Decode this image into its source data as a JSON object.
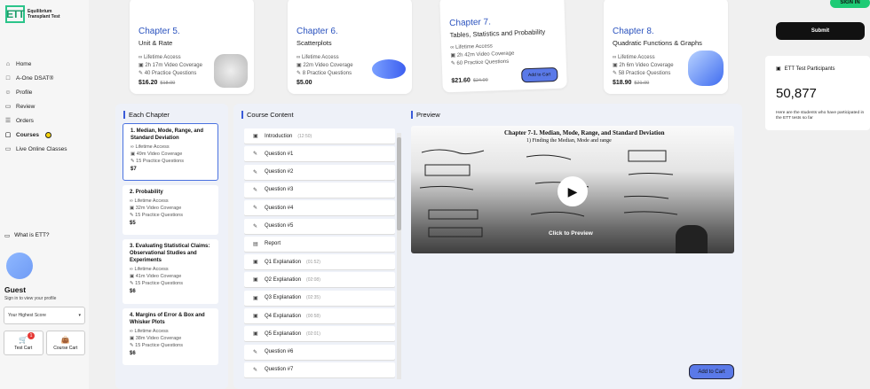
{
  "logo": {
    "mark": "ETT",
    "line1": "Equilibrium",
    "line2": "Transplant Test"
  },
  "nav": [
    {
      "icon": "⌂",
      "label": "Home"
    },
    {
      "icon": "□",
      "label": "A-One DSAT®"
    },
    {
      "icon": "☺",
      "label": "Profile"
    },
    {
      "icon": "▭",
      "label": "Review"
    },
    {
      "icon": "☰",
      "label": "Orders"
    },
    {
      "icon": "▢",
      "label": "Courses"
    },
    {
      "icon": "▭",
      "label": "Live Online Classes"
    }
  ],
  "sidebar": {
    "whatis": "What is ETT?",
    "guest": "Guest",
    "signin_prompt": "Sign in to view your profile",
    "score_placeholder": "Your Highest Score",
    "test_cart": "Test Cart",
    "test_cart_count": "1",
    "course_cart": "Course Cart"
  },
  "chapters": [
    {
      "title": "Chapter 5.",
      "subtitle": "Unit & Rate",
      "access": "Lifetime Access",
      "video": "2h 17m Video Coverage",
      "practice": "40 Practice Questions",
      "price": "$16.20",
      "old_price": "$18.00"
    },
    {
      "title": "Chapter 6.",
      "subtitle": "Scatterplots",
      "access": "Lifetime Access",
      "video": "22m Video Coverage",
      "practice": "8 Practice Questions",
      "price": "$5.00",
      "old_price": ""
    },
    {
      "title": "Chapter 7.",
      "subtitle": "Tables, Statistics and Probability",
      "access": "Lifetime Access",
      "video": "2h 42m Video Coverage",
      "practice": "60 Practice Questions",
      "price": "$21.60",
      "old_price": "$24.00",
      "button": "Add to Cart"
    },
    {
      "title": "Chapter 8.",
      "subtitle": "Quadratic Functions & Graphs",
      "access": "Lifetime Access",
      "video": "2h 6m Video Coverage",
      "practice": "58 Practice Questions",
      "price": "$18.90",
      "old_price": "$21.00"
    }
  ],
  "each_chapter": {
    "heading": "Each Chapter",
    "items": [
      {
        "title": "1. Median, Mode, Range, and Standard Deviation",
        "access": "Lifetime Access",
        "video": "49m Video Coverage",
        "practice": "15 Practice Questions",
        "price": "$7"
      },
      {
        "title": "2. Probability",
        "access": "Lifetime Access",
        "video": "32m Video Coverage",
        "practice": "15 Practice Questions",
        "price": "$5"
      },
      {
        "title": "3. Evaluating Statistical Claims: Observational Studies and Experiments",
        "access": "Lifetime Access",
        "video": "41m Video Coverage",
        "practice": "15 Practice Questions",
        "price": "$6"
      },
      {
        "title": "4. Margins of Error & Box and Whisker Plots",
        "access": "Lifetime Access",
        "video": "38m Video Coverage",
        "practice": "15 Practice Questions",
        "price": "$6"
      }
    ]
  },
  "course_content": {
    "heading": "Course Content",
    "items": [
      {
        "icon": "▣",
        "label": "Introduction",
        "duration": "(12:50)"
      },
      {
        "icon": "✎",
        "label": "Question #1",
        "duration": ""
      },
      {
        "icon": "✎",
        "label": "Question #2",
        "duration": ""
      },
      {
        "icon": "✎",
        "label": "Question #3",
        "duration": ""
      },
      {
        "icon": "✎",
        "label": "Question #4",
        "duration": ""
      },
      {
        "icon": "✎",
        "label": "Question #5",
        "duration": ""
      },
      {
        "icon": "▤",
        "label": "Report",
        "duration": ""
      },
      {
        "icon": "▣",
        "label": "Q1 Explanation",
        "duration": "(01:52)"
      },
      {
        "icon": "▣",
        "label": "Q2 Explanation",
        "duration": "(02:08)"
      },
      {
        "icon": "▣",
        "label": "Q3 Explanation",
        "duration": "(02:35)"
      },
      {
        "icon": "▣",
        "label": "Q4 Explanation",
        "duration": "(00:58)"
      },
      {
        "icon": "▣",
        "label": "Q5 Explanation",
        "duration": "(02:01)"
      },
      {
        "icon": "✎",
        "label": "Question #6",
        "duration": ""
      },
      {
        "icon": "✎",
        "label": "Question #7",
        "duration": ""
      }
    ]
  },
  "preview": {
    "heading": "Preview",
    "note_title": "Chapter 7-1. Median, Mode, Range, and Standard Deviation",
    "note_sub": "1) Finding the Median, Mode and range",
    "click_label": "Click to Preview",
    "add_to_cart": "Add to Cart"
  },
  "right": {
    "sign_in": "SIGN IN",
    "submit": "Submit",
    "participants_heading": "ETT Test Participants",
    "participants_count": "50,877",
    "participants_desc": "Here are the students who have participated in the ETT tests so far"
  }
}
